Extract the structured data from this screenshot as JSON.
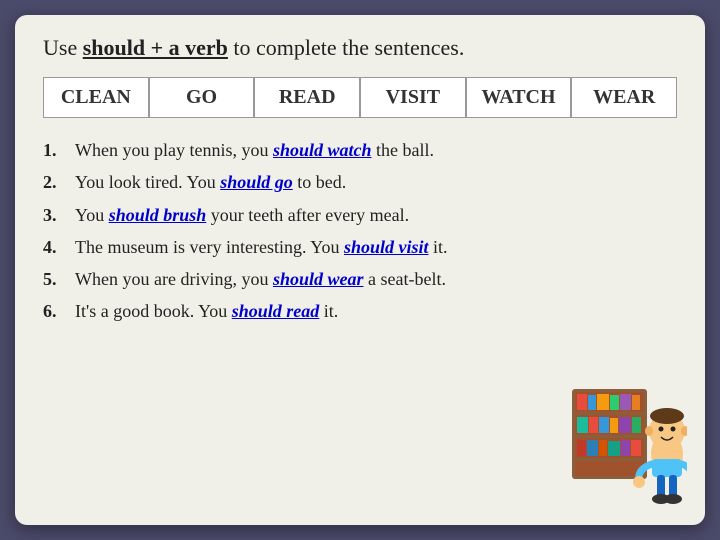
{
  "slide": {
    "title_prefix": "Use ",
    "title_underline": "should + a verb",
    "title_suffix": " to complete the sentences.",
    "words": [
      "CLEAN",
      "GO",
      "READ",
      "VISIT",
      "WATCH",
      "WEAR"
    ],
    "sentences": [
      {
        "num": "1.",
        "before": "When you play tennis, you ",
        "answer": "should watch",
        "after": " the ball."
      },
      {
        "num": "2.",
        "before": "You look tired. You ",
        "answer": "should go",
        "after": " to bed."
      },
      {
        "num": "3.",
        "before": "You ",
        "answer": "should brush",
        "after": " your teeth after every meal."
      },
      {
        "num": "4.",
        "before": "The museum is very interesting. You ",
        "answer": "should visit",
        "after": " it."
      },
      {
        "num": "5.",
        "before": "When you are driving, you ",
        "answer": "should wear",
        "after": " a seat-belt."
      },
      {
        "num": "6.",
        "before": "It's a good book. You ",
        "answer": "should read",
        "after": " it."
      }
    ]
  }
}
